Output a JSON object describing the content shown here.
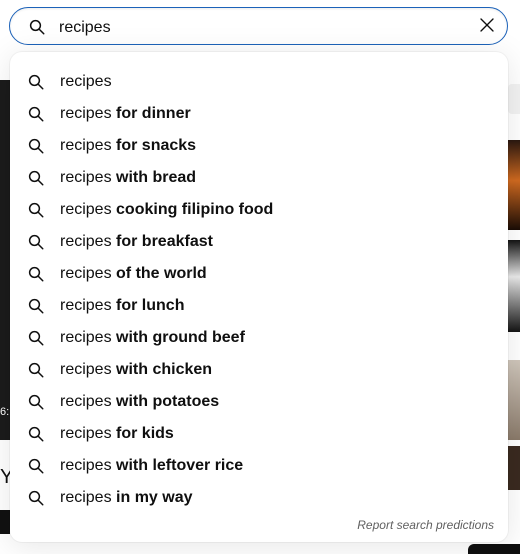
{
  "search": {
    "value": "recipes",
    "search_icon": "search-icon",
    "clear_icon": "close-icon"
  },
  "suggestions": [
    {
      "query": "recipes",
      "completion": ""
    },
    {
      "query": "recipes",
      "completion": " for dinner"
    },
    {
      "query": "recipes",
      "completion": " for snacks"
    },
    {
      "query": "recipes",
      "completion": " with bread"
    },
    {
      "query": "recipes",
      "completion": " cooking filipino food"
    },
    {
      "query": "recipes",
      "completion": " for breakfast"
    },
    {
      "query": "recipes",
      "completion": " of the world"
    },
    {
      "query": "recipes",
      "completion": " for lunch"
    },
    {
      "query": "recipes",
      "completion": " with ground beef"
    },
    {
      "query": "recipes",
      "completion": " with chicken"
    },
    {
      "query": "recipes",
      "completion": " with potatoes"
    },
    {
      "query": "recipes",
      "completion": " for kids"
    },
    {
      "query": "recipes",
      "completion": " with leftover rice"
    },
    {
      "query": "recipes",
      "completion": " in my way"
    }
  ],
  "report_link": "Report search predictions",
  "background": {
    "left_fragment_text": "6:",
    "left_fragment_letter": "Y"
  },
  "colors": {
    "accent_border": "#1c62b9",
    "text": "#0f0f0f",
    "muted": "#606060"
  }
}
